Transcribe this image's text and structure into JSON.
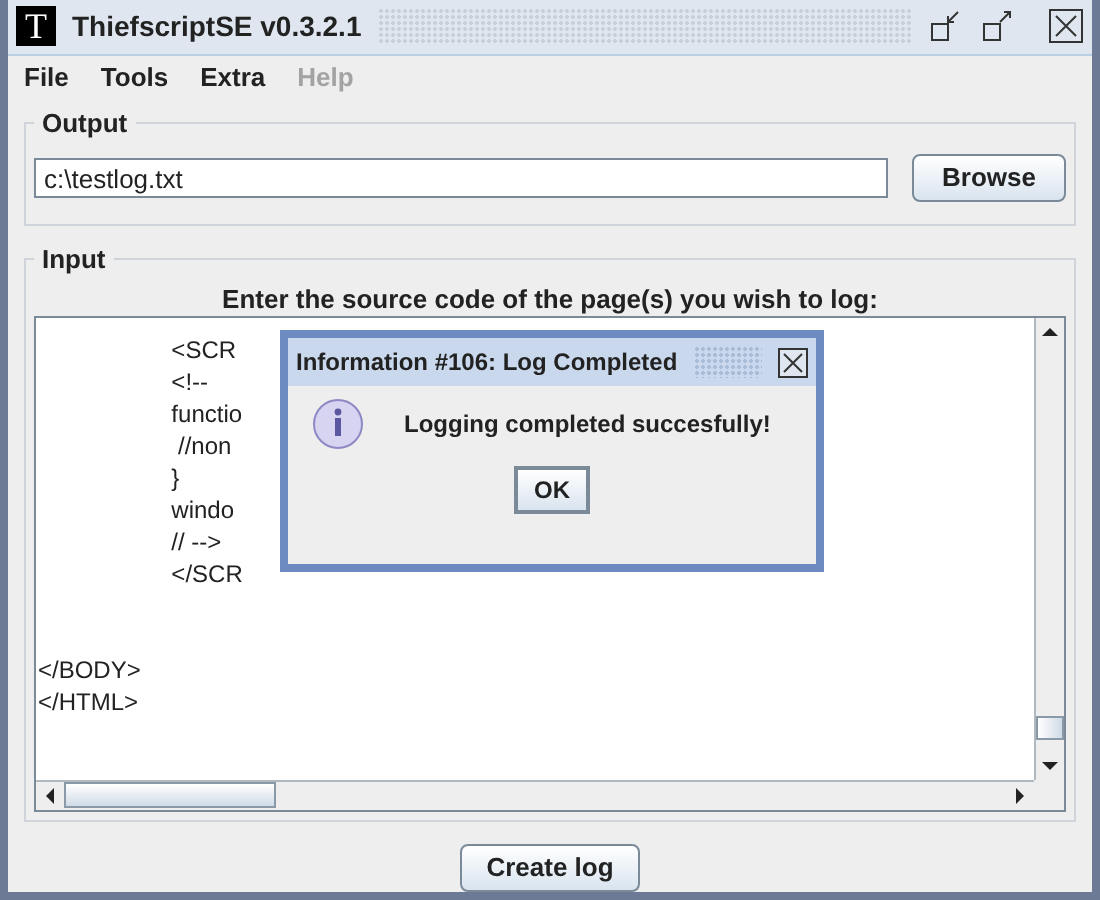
{
  "window": {
    "title": "ThiefscriptSE v0.3.2.1",
    "logo": "T"
  },
  "menu": [
    {
      "label": "File",
      "disabled": false
    },
    {
      "label": "Tools",
      "disabled": false
    },
    {
      "label": "Extra",
      "disabled": false
    },
    {
      "label": "Help",
      "disabled": true
    }
  ],
  "output": {
    "legend": "Output",
    "value": "c:\\testlog.txt",
    "button": "Browse"
  },
  "input": {
    "legend": "Input",
    "prompt": "Enter the source code of the page(s) you wish to log:",
    "script_lines": [
      "                    <SCR",
      "                    <!--",
      "                    functio",
      "                     //non",
      "                    }",
      "                    windo",
      "                    // -->",
      "                    </SCR"
    ],
    "tail_lines": [
      "</BODY>",
      "</HTML>"
    ]
  },
  "create_button": "Create log",
  "dialog": {
    "title": "Information #106: Log Completed",
    "message": "Logging completed succesfully!",
    "button": "OK"
  }
}
